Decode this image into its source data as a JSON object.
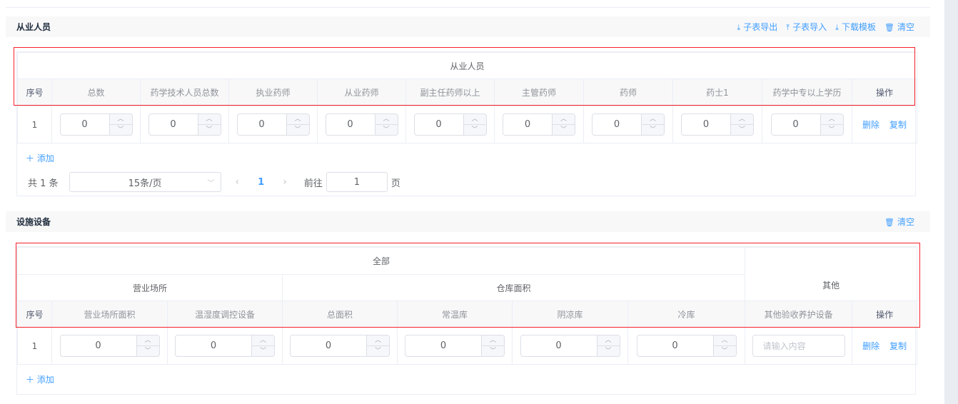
{
  "section1": {
    "title": "从业人员",
    "actions": [
      "子表导出",
      "子表导入",
      "下载模板",
      "清空"
    ],
    "group_header": "从业人员",
    "columns": [
      "序号",
      "总数",
      "药学技术人员总数",
      "执业药师",
      "从业药师",
      "副主任药师以上",
      "主管药师",
      "药师",
      "药士1",
      "药学中专以上学历",
      "操作"
    ],
    "row": {
      "index": "1",
      "values": [
        "0",
        "0",
        "0",
        "0",
        "0",
        "0",
        "0",
        "0",
        "0"
      ],
      "delete": "删除",
      "copy": "复制"
    },
    "add": "添加",
    "pagination": {
      "total": "共 1 条",
      "page_size": "15条/页",
      "current": "1",
      "goto_label": "前往",
      "goto_value": "1",
      "page_suffix": "页"
    }
  },
  "section2": {
    "title": "设施设备",
    "actions": [
      "清空"
    ],
    "header_all": "全部",
    "header_business": "营业场所",
    "header_warehouse": "仓库面积",
    "header_other": "其他",
    "columns": [
      "序号",
      "营业场所面积",
      "温湿度调控设备",
      "总面积",
      "常温库",
      "阴凉库",
      "冷库",
      "其他验收养护设备",
      "操作"
    ],
    "row": {
      "index": "1",
      "values": [
        "0",
        "0",
        "0",
        "0",
        "0",
        "0"
      ],
      "placeholder": "请输入内容",
      "delete": "删除",
      "copy": "复制"
    },
    "add": "添加"
  }
}
